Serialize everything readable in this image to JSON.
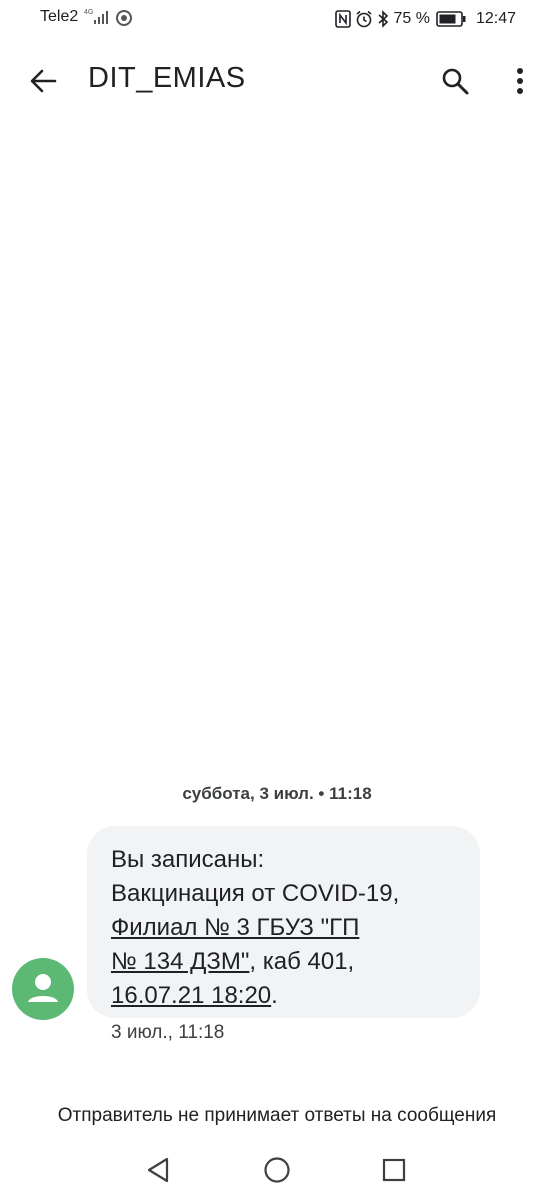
{
  "status_bar": {
    "carrier": "Tele2",
    "network": "4G",
    "battery_percent": "75 %",
    "time": "12:47",
    "icons": [
      "signal-icon",
      "chrome-icon",
      "nfc-icon",
      "alarm-icon",
      "bluetooth-icon",
      "battery-icon"
    ]
  },
  "header": {
    "title": "DIT_EMIAS",
    "icons": [
      "back-arrow-icon",
      "search-icon",
      "more-vert-icon"
    ]
  },
  "conversation": {
    "date_separator": {
      "day": "суббота, 3 июл.",
      "time": "11:18"
    },
    "message": {
      "line1": "Вы записаны:",
      "line2": "Вакцинация от COVID-19,",
      "link_line3": "Филиал № 3 ГБУЗ \"ГП",
      "link_line4a": "№ 134 ДЗМ\"",
      "line4b": ", каб 401,",
      "link_line5": "16.07.21 18:20",
      "line5_end": ".",
      "timestamp": "3 июл., 11:18"
    },
    "sender_avatar_icon": "person-icon",
    "reply_notice": "Отправитель не принимает ответы на сообщения"
  },
  "nav_bar": {
    "icons": [
      "nav-back-icon",
      "nav-home-icon",
      "nav-recents-icon"
    ]
  },
  "colors": {
    "avatar": "#5bb974",
    "bubble": "#f1f3f4",
    "text": "#202124"
  }
}
